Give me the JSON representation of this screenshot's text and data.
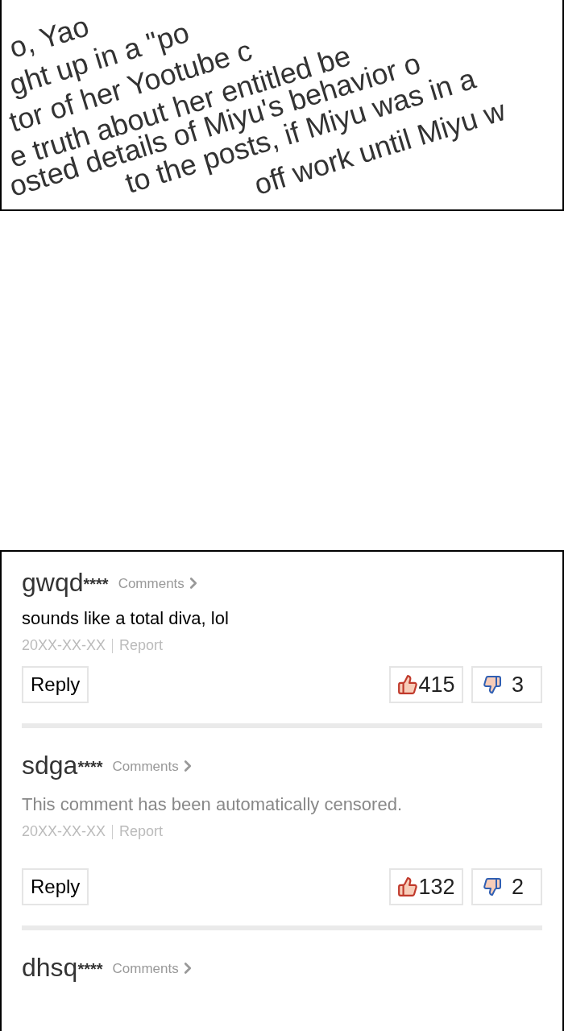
{
  "panel": {
    "lines": [
      "o, Yao",
      "ght up in a \"po",
      "tor of her Yootube c",
      "e truth about her entitled be",
      "osted details of Miyu's behavior o",
      "to the posts, if Miyu was in a",
      "off work until Miyu w"
    ]
  },
  "comments": [
    {
      "username": "gwqd",
      "mask": "****",
      "link": "Comments",
      "text": "sounds like a total diva, lol",
      "censored": false,
      "date": "20XX-XX-XX",
      "report": "Report",
      "reply": "Reply",
      "likes": "415",
      "dislikes": "3"
    },
    {
      "username": "sdga",
      "mask": "****",
      "link": "Comments",
      "text": "This comment has been automatically censored.",
      "censored": true,
      "date": "20XX-XX-XX",
      "report": "Report",
      "reply": "Reply",
      "likes": "132",
      "dislikes": "2"
    },
    {
      "username": "dhsq",
      "mask": "****",
      "link": "Comments"
    }
  ]
}
